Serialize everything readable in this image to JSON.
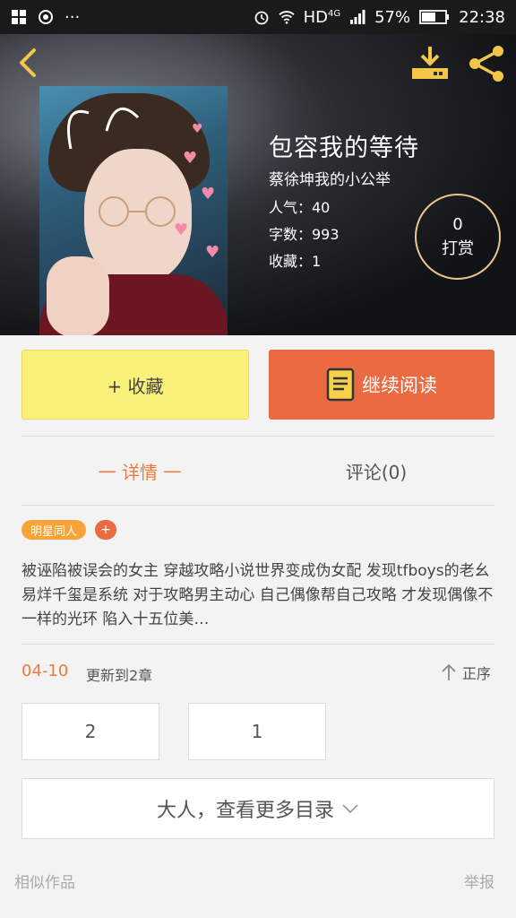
{
  "status_bar": {
    "network": "HD",
    "network_type": "4G",
    "battery": "57%",
    "time": "22:38",
    "dots": "···"
  },
  "book": {
    "title": "包容我的等待",
    "author": "蔡徐坤我的小公举",
    "popularity": "人气：40",
    "word_count": "字数：993",
    "favorites": "收藏：1"
  },
  "tip": {
    "count": "0",
    "label": "打赏"
  },
  "actions": {
    "collect": "+ 收藏",
    "continue_reading": "继续阅读"
  },
  "tabs": [
    {
      "label": "一 详情 一"
    },
    {
      "label": "评论(0)"
    }
  ],
  "tag": {
    "label": "明星同人",
    "add": "+"
  },
  "description": "被诬陷被误会的女主 穿越攻略小说世界变成伪女配 发现tfboys的老幺易烊千玺是系统 对于攻略男主动心 自己偶像帮自己攻略 才发现偶像不一样的光环 陷入十五位美…",
  "update": {
    "date": "04-10",
    "text": "更新到2章",
    "sort": "正序"
  },
  "chapters": [
    "2",
    "1"
  ],
  "more_catalog": "大人，查看更多目录",
  "footer": {
    "similar": "相似作品",
    "report": "举报"
  },
  "colors": {
    "accent_orange": "#ea6a41",
    "collect_yellow": "#faf17a",
    "icon_gold": "#f3c64a"
  }
}
